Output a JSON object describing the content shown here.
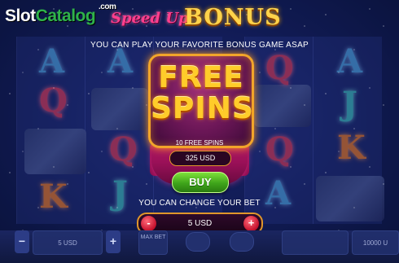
{
  "logo": {
    "brand_part1": "Slot",
    "brand_part2": "Catalog",
    "suffix": ".com"
  },
  "header": {
    "title_script": "Speed Up",
    "title_main": "BONUS",
    "subtitle": "YOU CAN PLAY YOUR FAVORITE BONUS GAME ASAP"
  },
  "bonus": {
    "free_word": "FREE",
    "spins_word": "SPINS",
    "spin_count_text": "10 FREE SPINS",
    "price": "325 USD",
    "buy_label": "BUY"
  },
  "bet": {
    "change_text": "YOU CAN CHANGE YOUR BET",
    "minus": "-",
    "plus": "+",
    "value": "5 USD"
  },
  "bottom_bar": {
    "bet_value": "5 USD",
    "max_bet_label": "MAX BET",
    "balance": "10000 U"
  },
  "reels": {
    "symbols": [
      "A",
      "Q",
      "J",
      "K"
    ]
  },
  "colors": {
    "accent_gold": "#ffcc2a",
    "buy_green": "#3ea41a",
    "panel_magenta": "#6a1656",
    "title_pink": "#ff3f8e"
  }
}
